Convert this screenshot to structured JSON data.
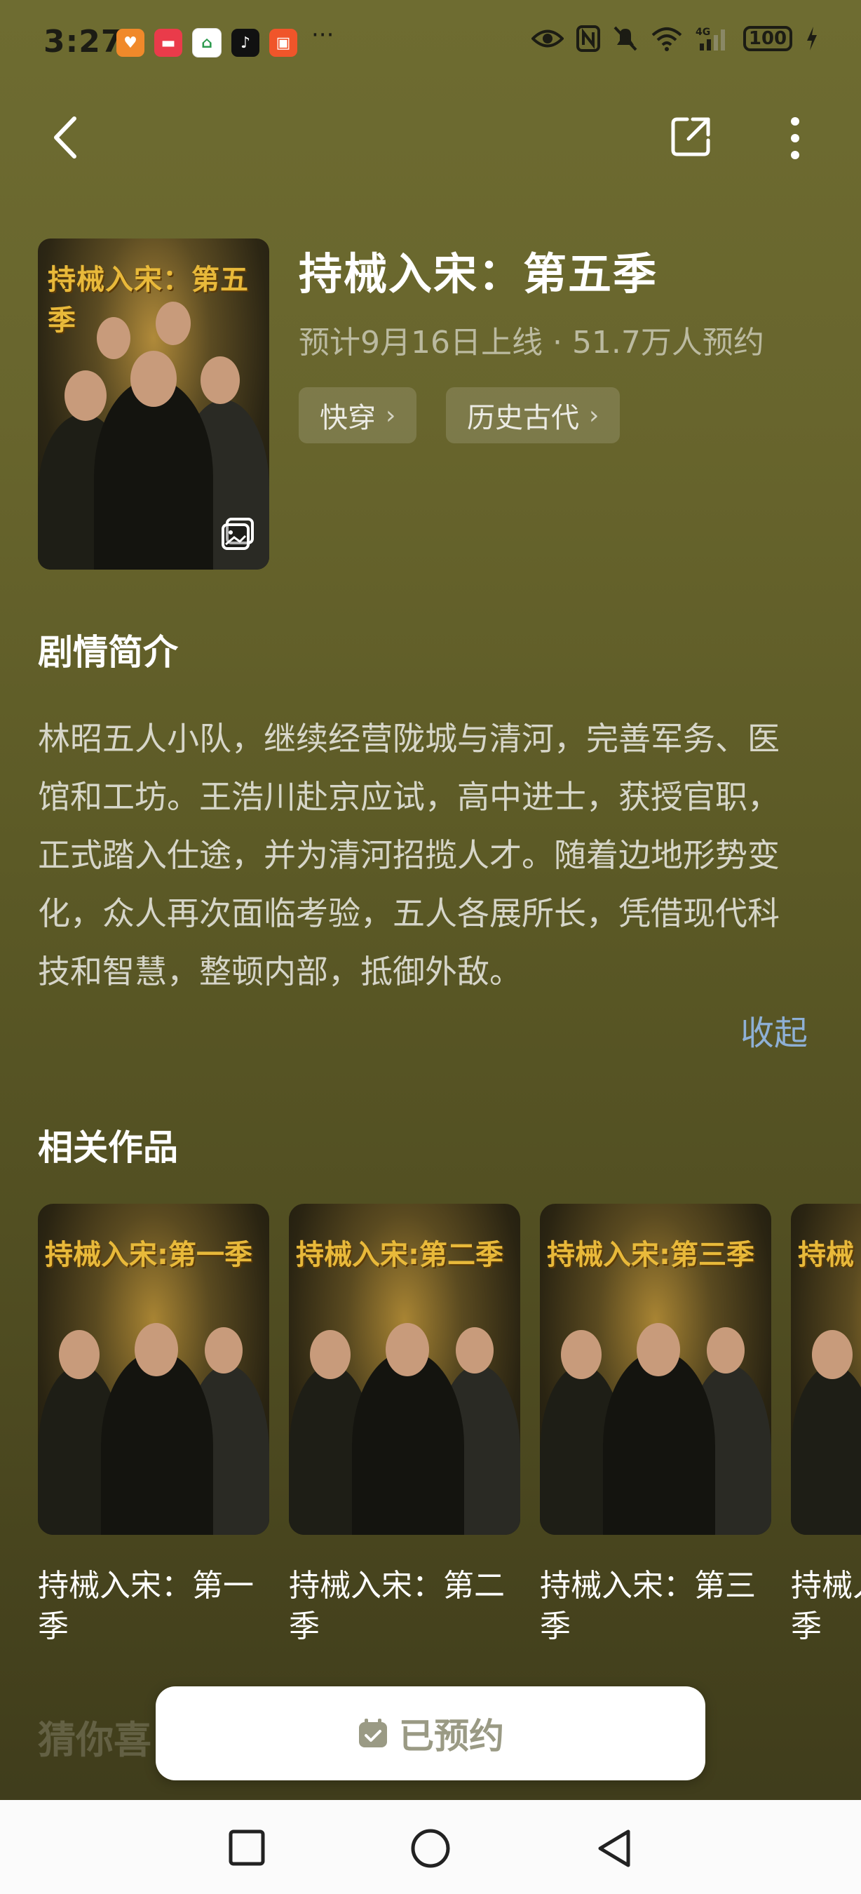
{
  "status_bar": {
    "time": "3:27",
    "dots": "···",
    "battery": "100"
  },
  "nav": {
    "back_icon": "chevron-left-icon",
    "share_icon": "share-icon",
    "more_icon": "more-vertical-icon"
  },
  "drama": {
    "poster_title": "持械入宋：第五季",
    "title": "持械入宋：第五季",
    "subtitle": "预计9月16日上线 · 51.7万人预约",
    "tags": [
      {
        "label": "快穿"
      },
      {
        "label": "历史古代"
      }
    ]
  },
  "synopsis": {
    "heading": "剧情简介",
    "text": "林昭五人小队，继续经营陇城与清河，完善军务、医馆和工坊。王浩川赴京应试，高中进士，获授官职，正式踏入仕途，并为清河招揽人才。随着边地形势变化，众人再次面临考验，五人各展所长，凭借现代科技和智慧，整顿内部，抵御外敌。",
    "collapse_label": "收起"
  },
  "related": {
    "heading": "相关作品",
    "items": [
      {
        "poster_title": "持械入宋:第一季",
        "title": "持械入宋：第一季"
      },
      {
        "poster_title": "持械入宋:第二季",
        "title": "持械入宋：第二季"
      },
      {
        "poster_title": "持械入宋:第三季",
        "title": "持械入宋：第三季"
      },
      {
        "poster_title": "持械",
        "title": "持械入宋：第四季"
      }
    ]
  },
  "guess_heading": "猜你喜",
  "reserve_button": {
    "label": "已预约",
    "icon": "calendar-check-icon"
  },
  "system_nav": {
    "recent_icon": "square-icon",
    "home_icon": "circle-icon",
    "back_icon": "triangle-back-icon"
  },
  "colors": {
    "accent_link": "#8eb0d6",
    "poster_gold": "#e8b93a"
  }
}
